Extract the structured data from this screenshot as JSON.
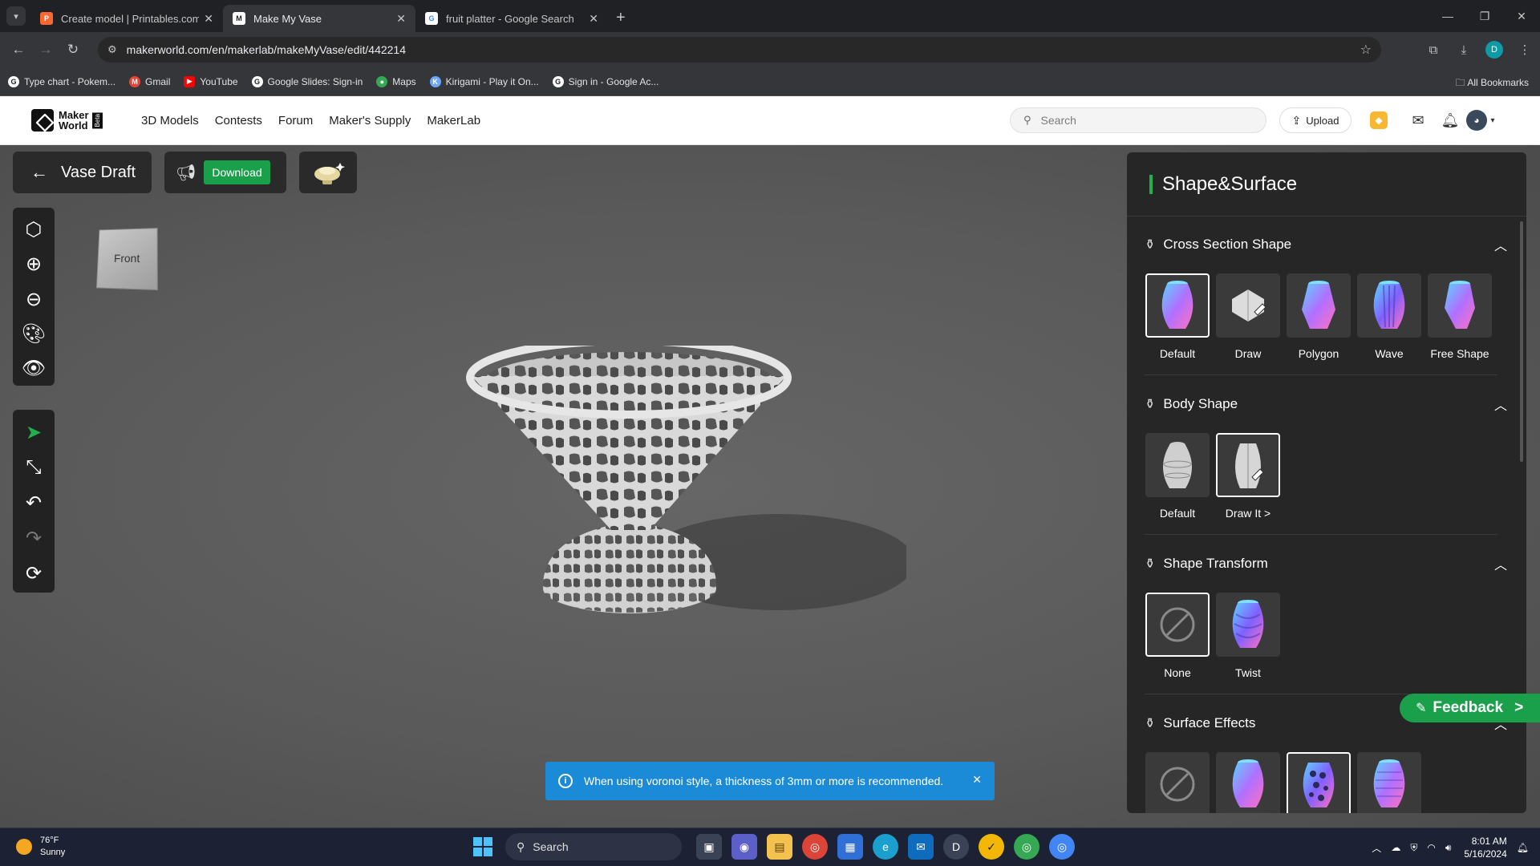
{
  "browser": {
    "tabs": [
      {
        "title": "Create model | Printables.com",
        "fav_color": "#fa6831",
        "fav_glyph": "P"
      },
      {
        "title": "Make My Vase",
        "fav_color": "#444444",
        "fav_glyph": "M"
      },
      {
        "title": "fruit platter - Google Search",
        "fav_color": "#ffffff",
        "fav_glyph": "G"
      }
    ],
    "url": "makerworld.com/en/makerlab/makeMyVase/edit/442214",
    "profile_initial": "D",
    "bookmarks": [
      {
        "label": "Type chart - Pokem...",
        "color": "#ffffff"
      },
      {
        "label": "Gmail",
        "color": "#ea4335"
      },
      {
        "label": "YouTube",
        "color": "#ff0000"
      },
      {
        "label": "Google Slides: Sign-in",
        "color": "#ffffff"
      },
      {
        "label": "Maps",
        "color": "#34a853"
      },
      {
        "label": "Kirigami - Play it On...",
        "color": "#6ea8fe"
      },
      {
        "label": "Sign in - Google Ac...",
        "color": "#ffffff"
      }
    ],
    "all_bookmarks": "All Bookmarks"
  },
  "site": {
    "logo_line1": "Maker",
    "logo_line2": "World",
    "logo_badge": "Beta",
    "nav": [
      "3D Models",
      "Contests",
      "Forum",
      "Maker's Supply",
      "MakerLab"
    ],
    "search_placeholder": "Search",
    "upload_label": "Upload"
  },
  "editor": {
    "back_label": "Vase Draft",
    "download_label": "Download",
    "view_cube_label": "Front",
    "toast": "When using voronoi style, a thickness of 3mm or more is recommended."
  },
  "panel": {
    "title": "Shape&Surface",
    "sections": [
      {
        "title": "Cross Section Shape",
        "options": [
          "Default",
          "Draw",
          "Polygon",
          "Wave",
          "Free Shape"
        ],
        "selected": 0
      },
      {
        "title": "Body Shape",
        "options": [
          "Default",
          "Draw It >"
        ],
        "selected": 1
      },
      {
        "title": "Shape Transform",
        "options": [
          "None",
          "Twist"
        ],
        "selected": 0
      },
      {
        "title": "Surface Effects",
        "options": [],
        "selected": 2
      }
    ]
  },
  "feedback_label": "Feedback",
  "taskbar": {
    "temp": "76°F",
    "condition": "Sunny",
    "search": "Search",
    "time": "8:01 AM",
    "date": "5/16/2024"
  },
  "colors": {
    "accent_green": "#1aa04a",
    "toast_blue": "#1b8bd8"
  }
}
